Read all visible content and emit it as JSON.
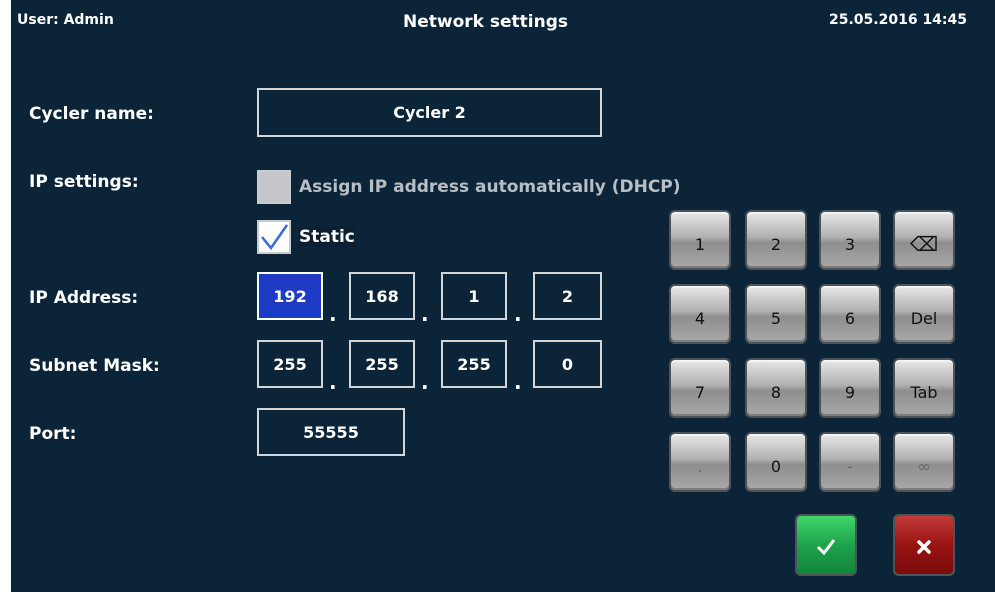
{
  "header": {
    "user": "User: Admin",
    "title": "Network settings",
    "datetime": "25.05.2016 14:45"
  },
  "form": {
    "cycler_name_label": "Cycler name:",
    "cycler_name_value": "Cycler 2",
    "ip_settings_label": "IP settings:",
    "dhcp_label": "Assign IP address automatically (DHCP)",
    "dhcp_checked": false,
    "static_label": "Static",
    "static_checked": true,
    "ip_address_label": "IP Address:",
    "ip_address": [
      "192",
      "168",
      "1",
      "2"
    ],
    "subnet_mask_label": "Subnet Mask:",
    "subnet_mask": [
      "255",
      "255",
      "255",
      "0"
    ],
    "port_label": "Port:",
    "port_value": "55555",
    "separator": "."
  },
  "keypad": {
    "keys": [
      "1",
      "2",
      "3",
      "⌫",
      "4",
      "5",
      "6",
      "Del",
      "7",
      "8",
      "9",
      "Tab",
      ".",
      "0",
      "-",
      "∞"
    ]
  },
  "actions": {
    "accept_icon": "check-icon",
    "cancel_icon": "close-icon"
  },
  "colors": {
    "background": "#0c2438",
    "active_field": "#1d3bc4",
    "accept": "#1ea34b",
    "cancel": "#9a1212",
    "disabled_text": "#b9bec4"
  }
}
